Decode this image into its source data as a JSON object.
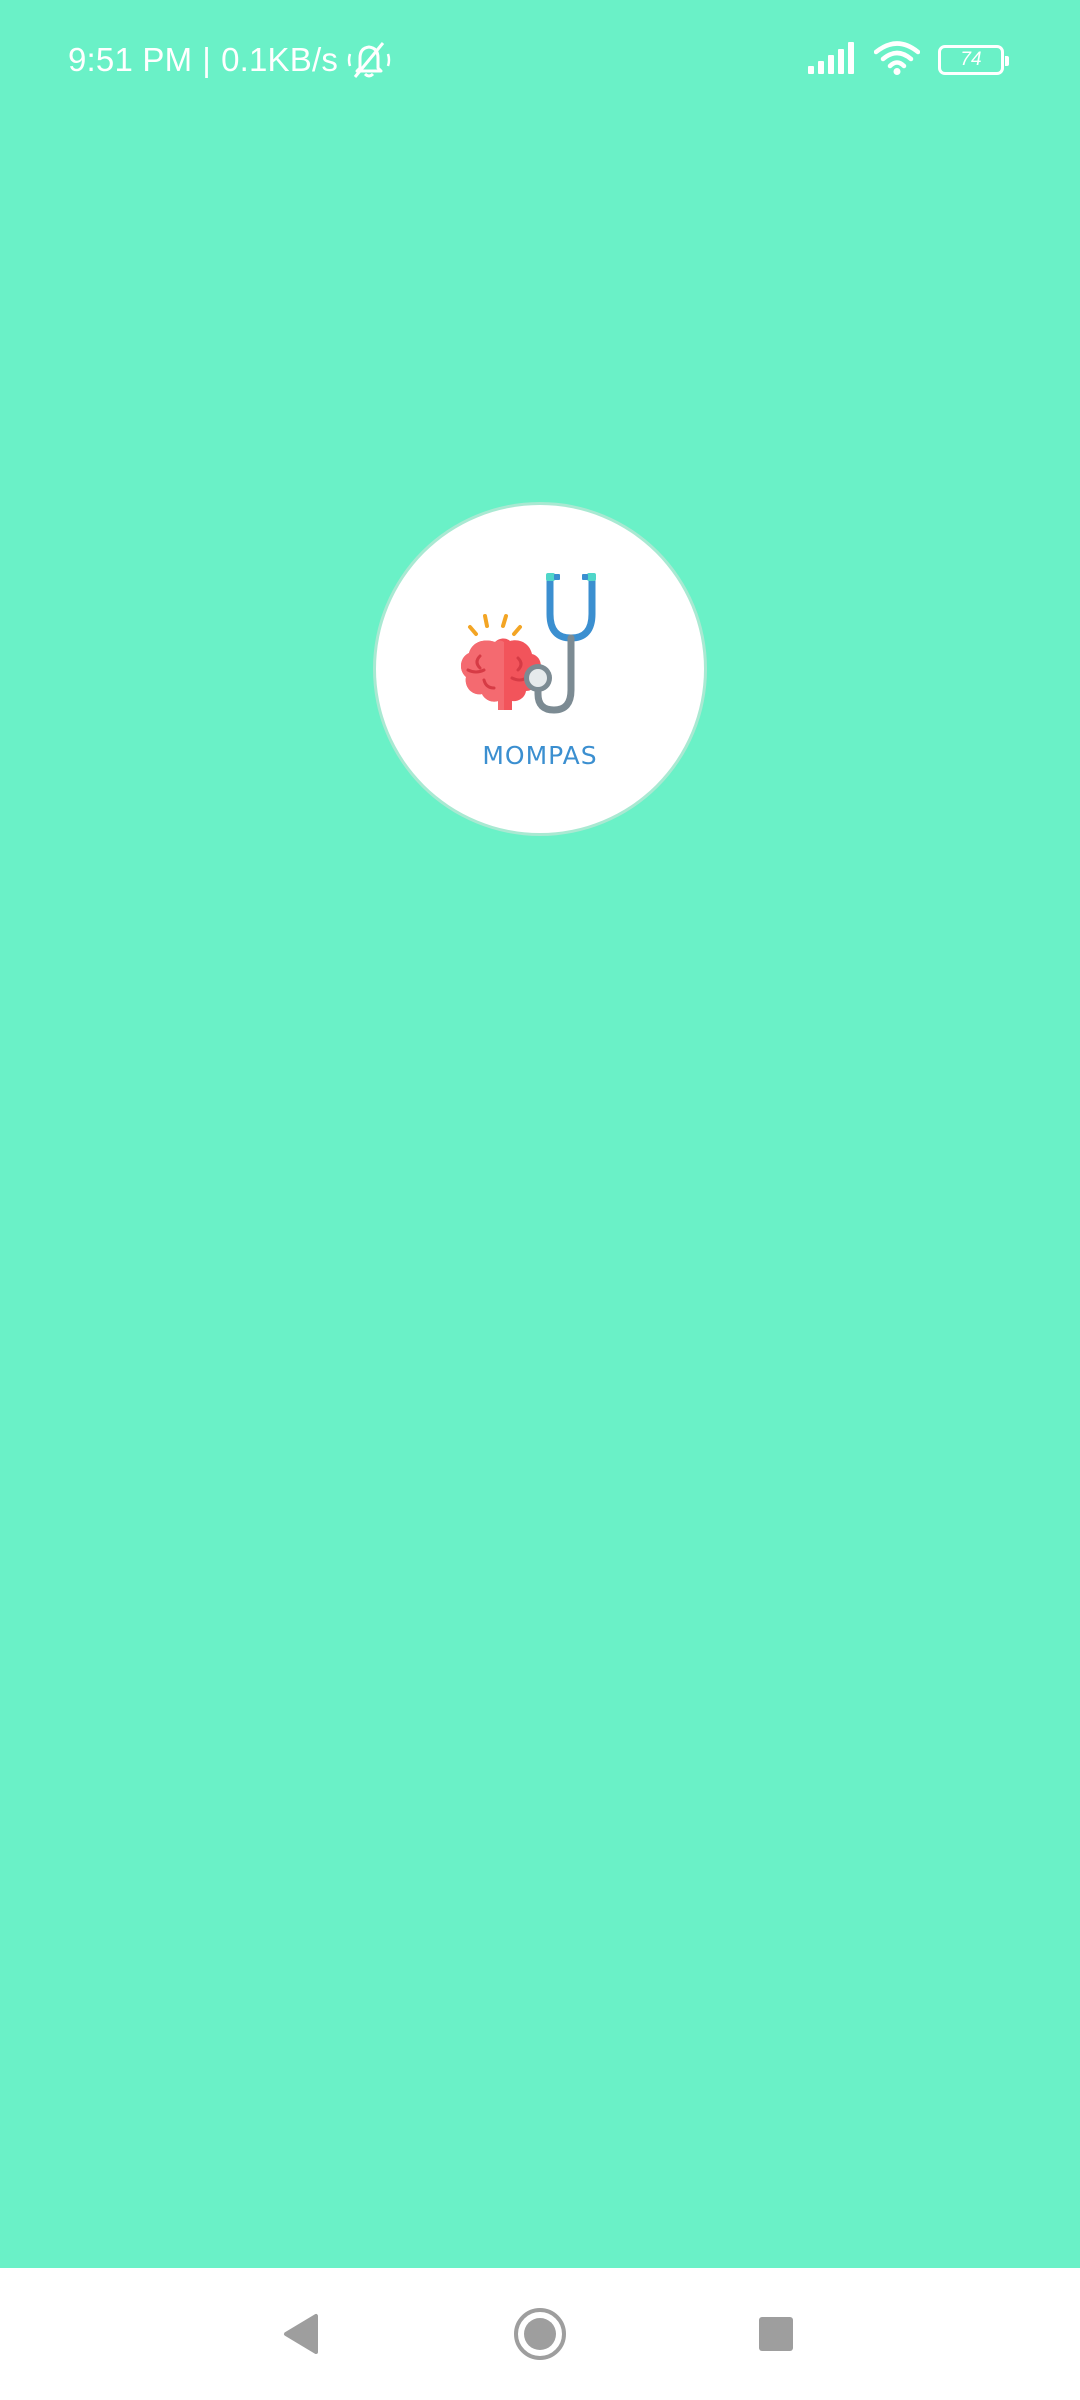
{
  "status_bar": {
    "time": "9:51 PM",
    "separator": "|",
    "network_speed": "0.1KB/s",
    "battery_level": "74",
    "icons": [
      "mute-icon",
      "signal-icon",
      "wifi-icon",
      "battery-icon"
    ]
  },
  "splash": {
    "logo_text": "MOMPAS",
    "logo_icons": [
      "brain-icon",
      "stethoscope-icon"
    ]
  },
  "nav_bar": {
    "icons": [
      "back-icon",
      "home-icon",
      "recents-icon"
    ]
  },
  "colors": {
    "background": "#6af1c7",
    "logo_circle": "#ffffff",
    "logo_text": "#3b8fd0",
    "brain": "#f2545b",
    "stethoscope_tube": "#3b8fd0",
    "nav_bar": "#ffffff",
    "nav_icons": "#9e9e9e"
  }
}
